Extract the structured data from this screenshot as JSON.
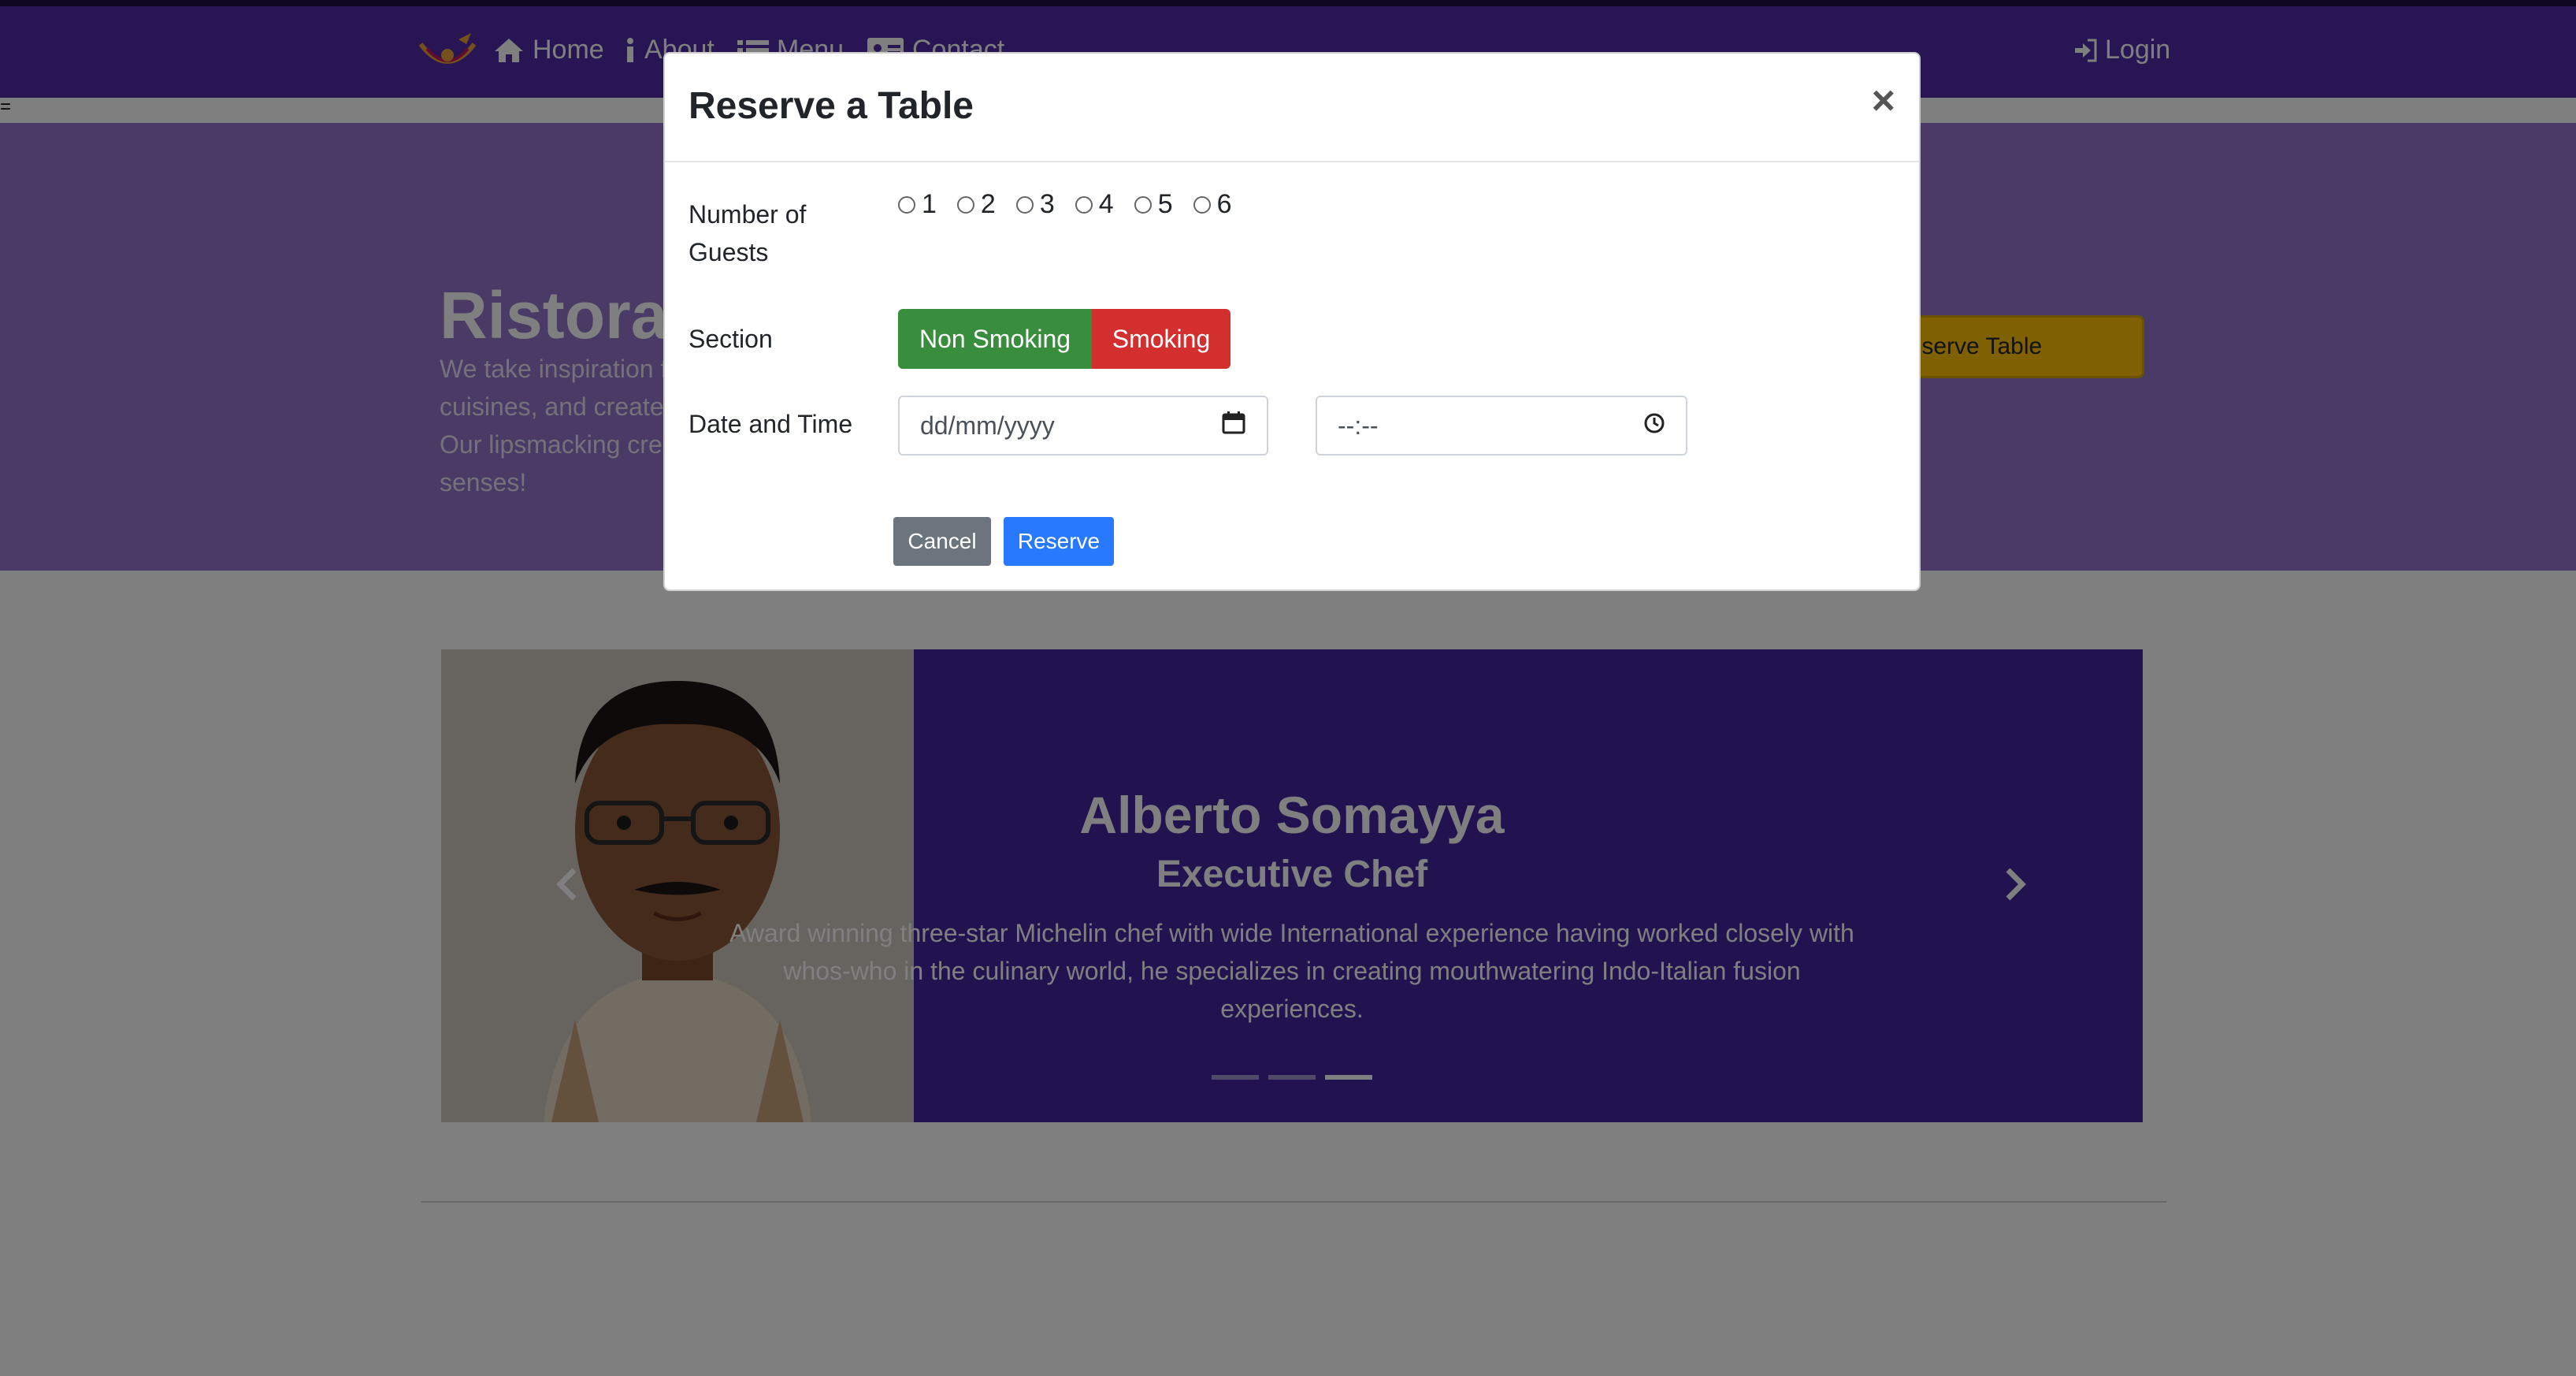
{
  "navbar": {
    "items": [
      {
        "label": "Home",
        "icon": "home-icon"
      },
      {
        "label": "About",
        "icon": "info-icon"
      },
      {
        "label": "Menu",
        "icon": "list-icon"
      },
      {
        "label": "Contact",
        "icon": "address-card-icon"
      }
    ],
    "login": {
      "label": "Login",
      "icon": "sign-in-icon"
    },
    "logo": "logo-icon"
  },
  "jumbotron": {
    "title": "Ristorante con Fusion",
    "text": "We take inspiration from the World's best cuisines, and create a unique fusion experience. Our lipsmacking creations will tickle your culinary senses!",
    "reserve_button": "Reserve Table"
  },
  "carousel": {
    "name": "Alberto Somayya",
    "role": "Executive Chef",
    "description": "Award winning three-star Michelin chef with wide International experience having worked closely with whos-who in the culinary world, he specializes in creating mouthwatering Indo-Italian fusion experiences.",
    "indicators": 3,
    "active_indicator": 3
  },
  "modal": {
    "title": "Reserve a Table",
    "close": "×",
    "guests_label": "Number of Guests",
    "guest_options": [
      "1",
      "2",
      "3",
      "4",
      "5",
      "6"
    ],
    "section_label": "Section",
    "section_options": [
      "Non Smoking",
      "Smoking"
    ],
    "datetime_label": "Date and Time",
    "date_placeholder": "dd/mm/yyyy",
    "time_placeholder": "--:--",
    "cancel": "Cancel",
    "reserve": "Reserve"
  },
  "colors": {
    "navbar": "#512da8",
    "jumbotron": "#9575cd",
    "carousel": "#4527a0",
    "non_smoking": "#388e3c",
    "smoking": "#d32f2f",
    "reserve": "#2979ff",
    "cancel": "#6c757d",
    "warning": "#ffc107"
  }
}
